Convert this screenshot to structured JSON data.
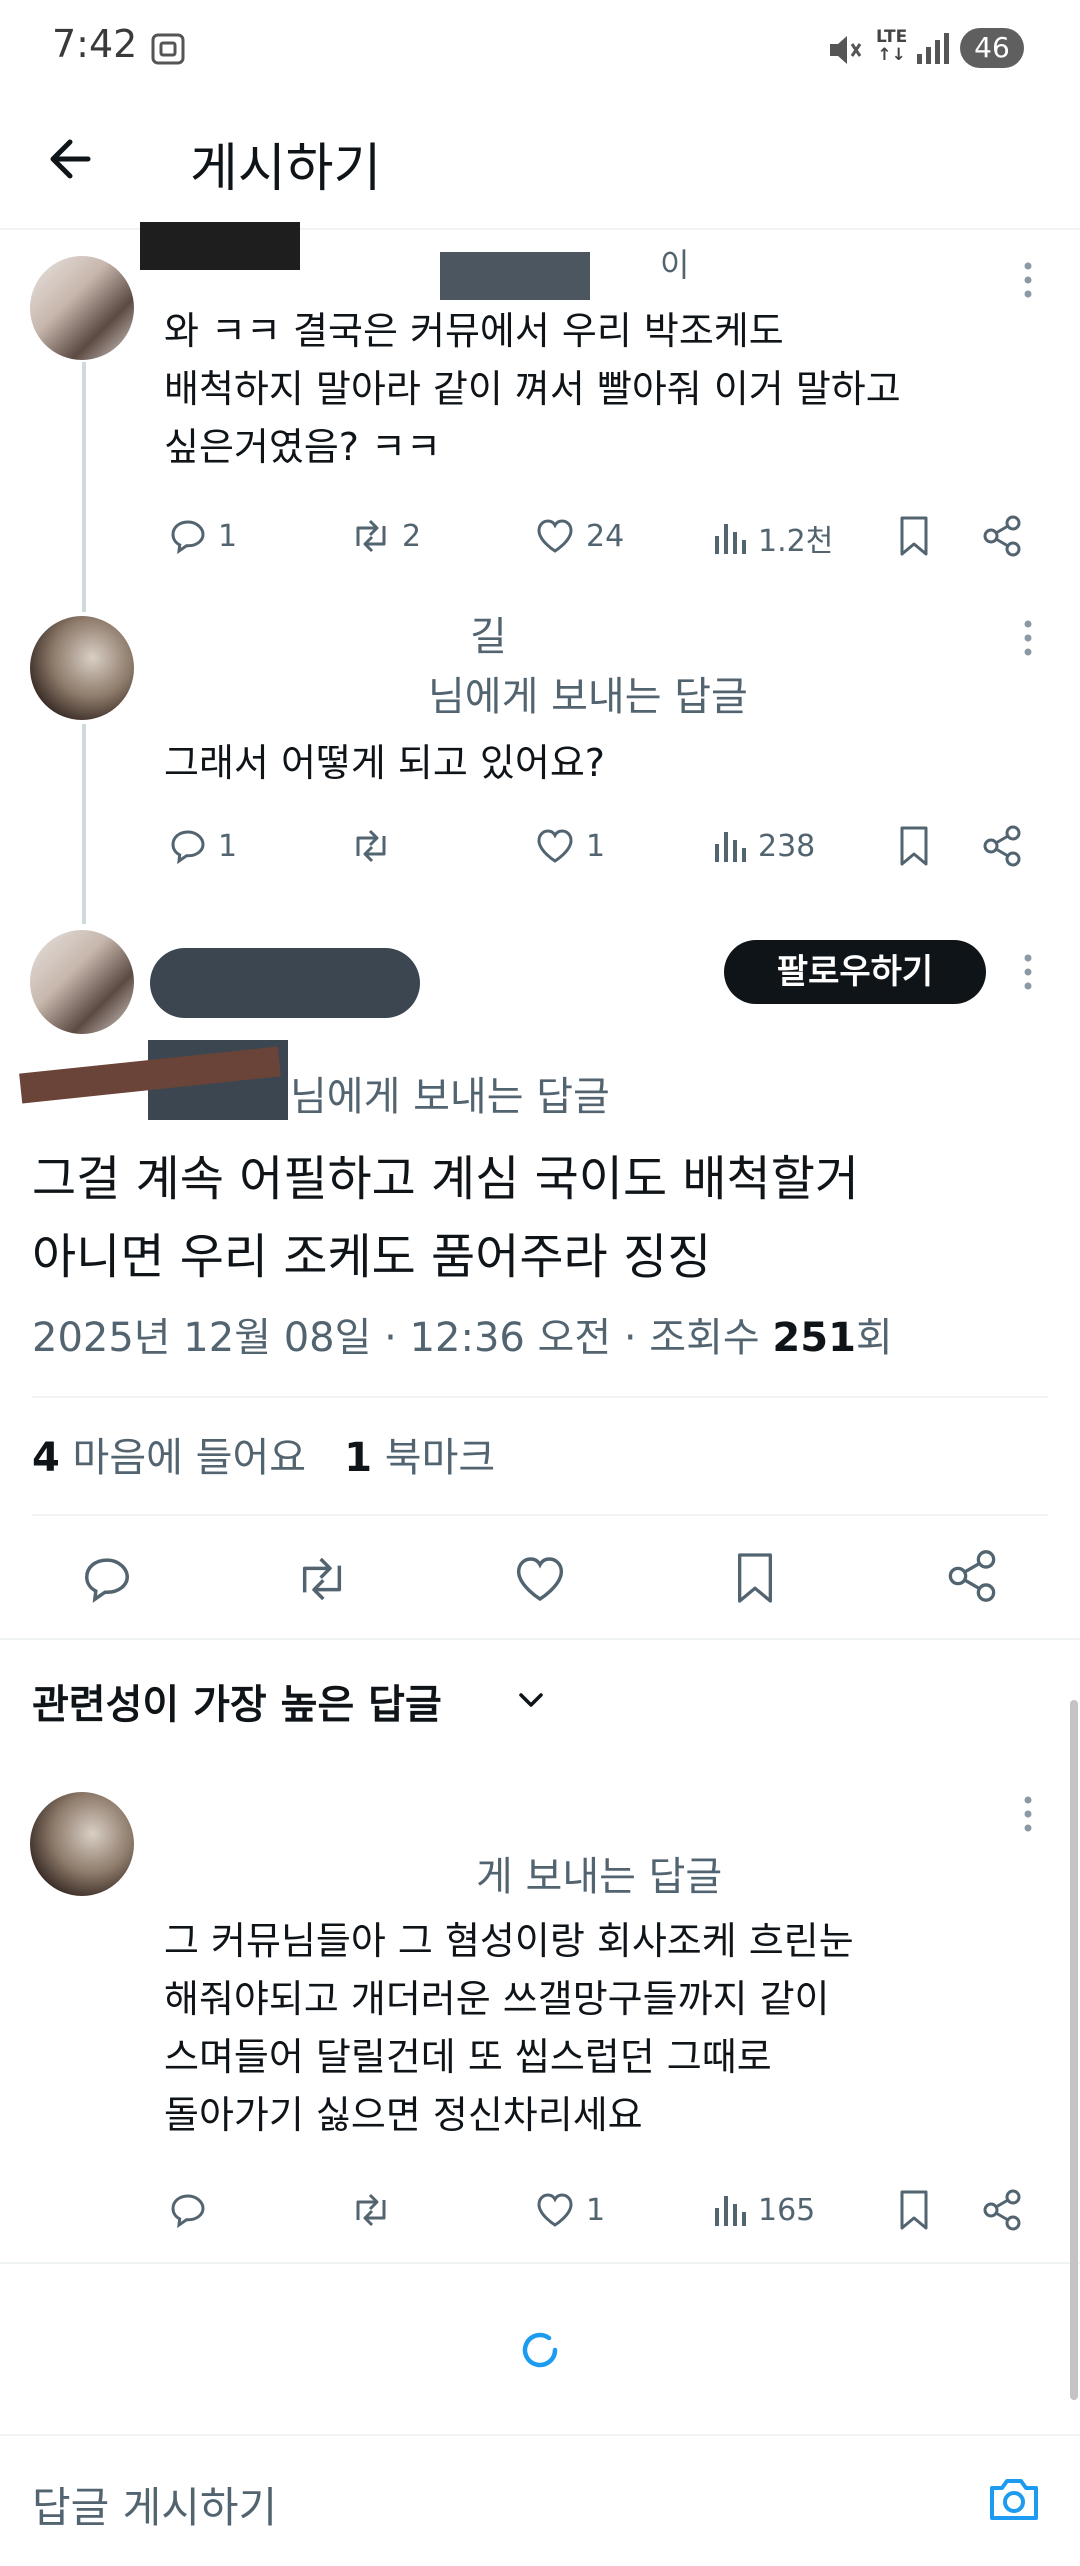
{
  "status_bar": {
    "time": "7:42",
    "network_top": "LTE",
    "network_bottom": "↑↓",
    "battery": "46",
    "icons": [
      "screenshot-icon",
      "mute-icon",
      "signal-icon"
    ]
  },
  "header": {
    "title": "게시하기",
    "back_icon": "arrow-left-icon"
  },
  "thread": [
    {
      "name_partial": "이",
      "text_lines": [
        "와 ㅋㅋ 결국은 커뮤에서 우리 박조케도",
        "배척하지 말아라 같이 껴서 빨아줘 이거 말하고",
        "싶은거였음? ㅋㅋ"
      ],
      "replies": "1",
      "reposts": "2",
      "likes": "24",
      "views": "1.2천"
    },
    {
      "name_partial": "길",
      "reply_to": "님에게 보내는 답글",
      "text": "그래서  어떻게 되고 있어요?",
      "replies": "1",
      "reposts": "",
      "likes": "1",
      "views": "238"
    }
  ],
  "main_post": {
    "follow_label": "팔로우하기",
    "reply_to": "님에게 보내는 답글",
    "text_lines": [
      "그걸 계속 어필하고 계심 국이도 배척할거",
      "아니면 우리 조케도 품어주라 징징"
    ],
    "date": "2025년 12월 08일 · 12:36 오전 · 조회수 ",
    "views": "251",
    "views_suffix": "회",
    "likes_count": "4",
    "likes_label": " 마음에 들어요",
    "bookmarks_count": "1",
    "bookmarks_label": " 북마크"
  },
  "replies_section": {
    "sort_label": "관련성이 가장 높은 답글",
    "replies": [
      {
        "reply_to": "게 보내는 답글",
        "text_lines": [
          "그 커뮤님들아 그 혐성이랑  회사조케 흐린눈",
          "해줘야되고  개더러운 쓰갤망구들까지 같이",
          "스며들어 달릴건데 또 씹스럽던 그때로",
          "돌아가기 싫으면 정신차리세요"
        ],
        "replies": "",
        "reposts": "",
        "likes": "1",
        "views": "165"
      }
    ]
  },
  "composer": {
    "placeholder": "답글 게시하기",
    "camera_icon": "camera-icon"
  },
  "colors": {
    "text": "#0f1419",
    "muted": "#536471",
    "accent": "#1d9bf0",
    "divider": "#eff3f4"
  }
}
